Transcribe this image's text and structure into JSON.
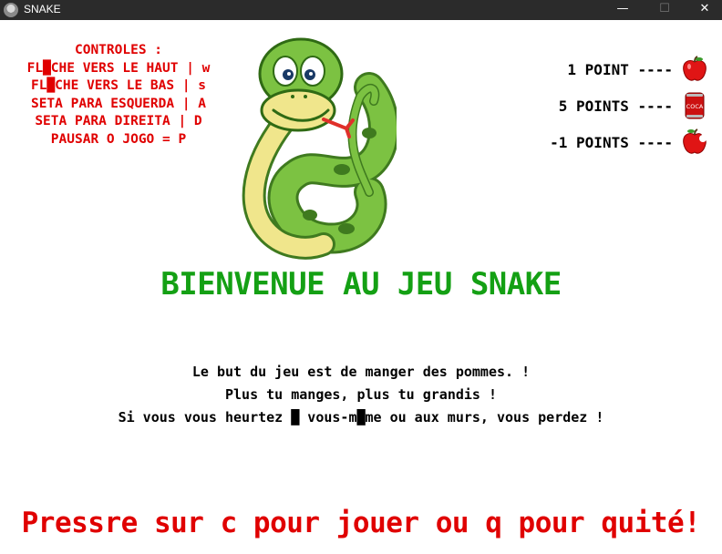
{
  "window": {
    "title": "SNAKE",
    "minimize_glyph": "—",
    "maximize_glyph": "☐",
    "close_glyph": "✕"
  },
  "controls": {
    "lines": [
      "CONTROLES :",
      "FL█CHE VERS LE HAUT | w",
      "FL█CHE VERS LE BAS | s",
      "SETA PARA ESQUERDA | A",
      "SETA PARA DIREITA | D",
      "PAUSAR O JOGO = P"
    ]
  },
  "points": [
    {
      "label": "1 POINT ----",
      "icon": "red-apple-icon"
    },
    {
      "label": "5 POINTS ----",
      "icon": "coca-can-icon"
    },
    {
      "label": "-1 POINTS ----",
      "icon": "bitten-apple-icon"
    }
  ],
  "can_label": "COCA",
  "welcome": "BIENVENUE AU JEU SNAKE",
  "description": [
    "Le but du jeu est de manger des pommes. !",
    "Plus tu manges, plus tu grandis !",
    "Si vous vous heurtez █ vous-m█me ou aux murs, vous perdez !"
  ],
  "prompt": "Pressre sur c pour jouer ou q pour quité!",
  "colors": {
    "titlebar": "#2b2b2b",
    "controls_text": "#e00000",
    "welcome_text": "#14a014",
    "prompt_text": "#e00000",
    "snake_green": "#7cc242"
  }
}
